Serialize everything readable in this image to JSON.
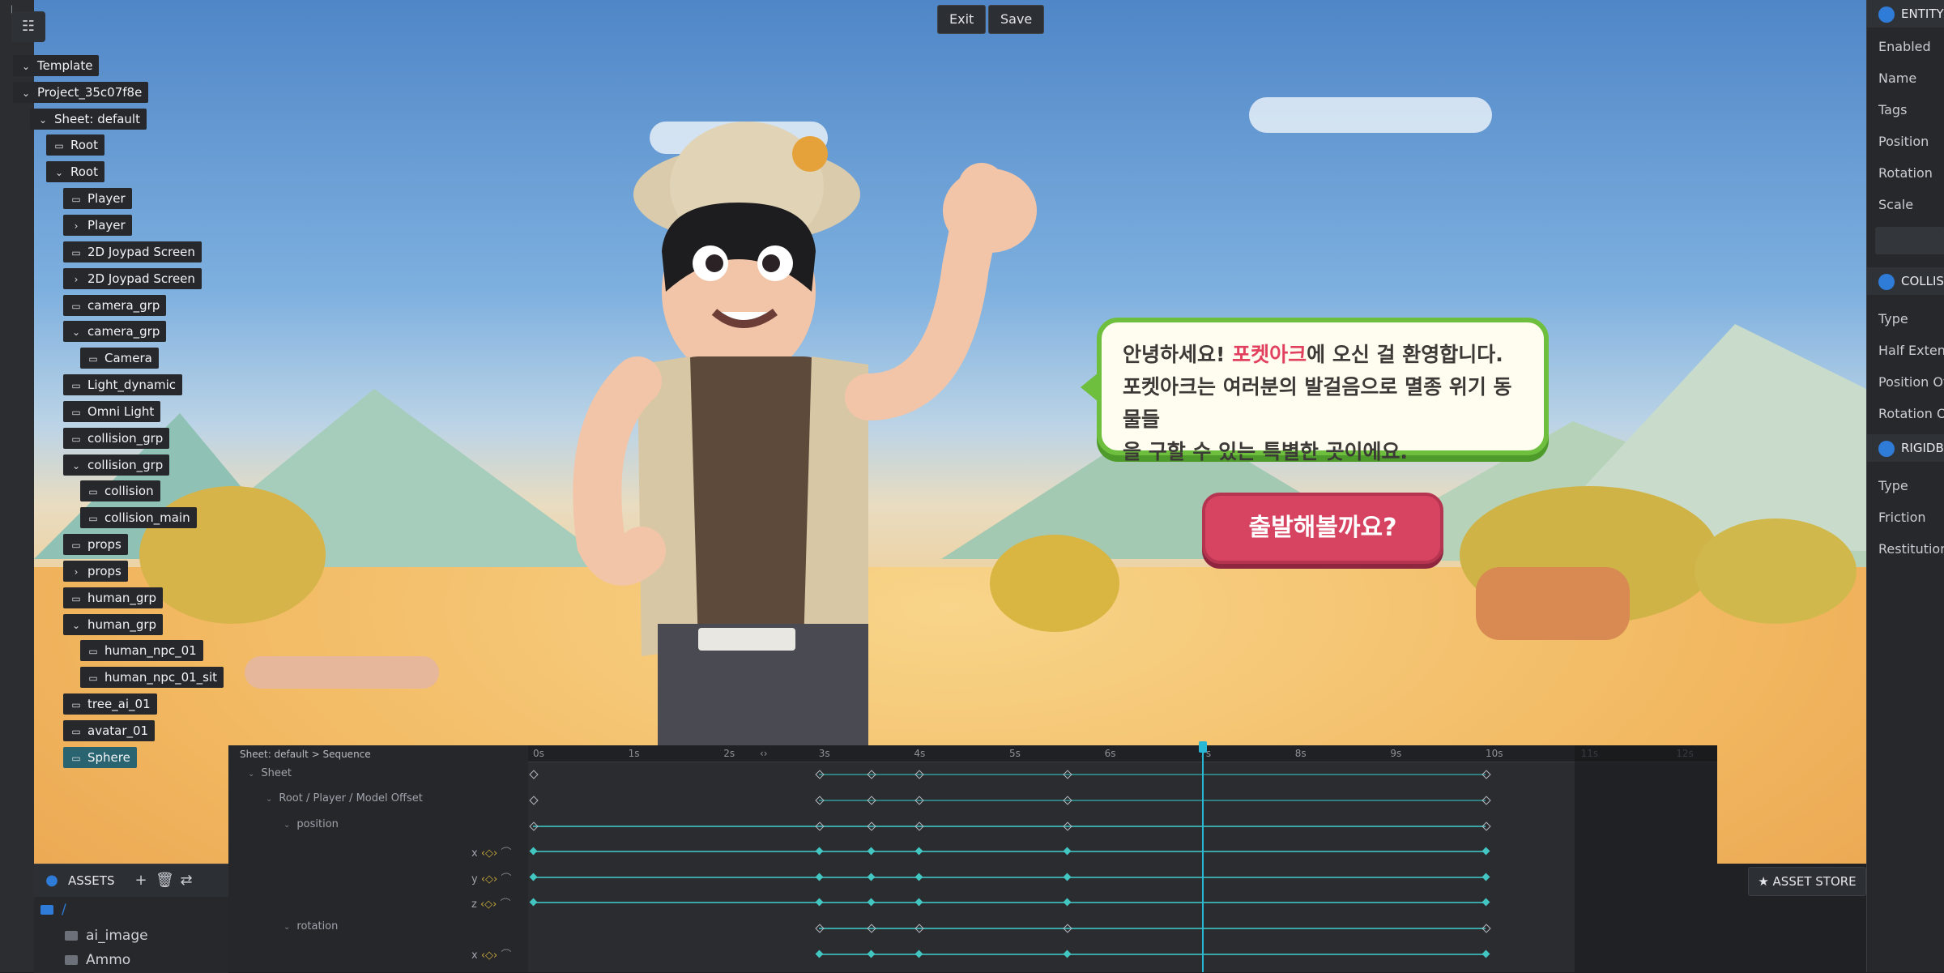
{
  "toolbar": {
    "exit_label": "Exit",
    "save_label": "Save"
  },
  "hierarchy": {
    "nodes": [
      {
        "label": "Template",
        "expanded": true,
        "icon": "chevron-down-icon"
      },
      {
        "label": "Project_35c07f8e",
        "expanded": true,
        "icon": "chevron-down-icon"
      },
      {
        "label": "Sheet: default",
        "expanded": true,
        "icon": "chevron-down-icon"
      },
      {
        "label": "Root",
        "icon": "entity-icon"
      },
      {
        "label": "Root",
        "icon": "chevron-down-icon"
      },
      {
        "label": "Player",
        "icon": "entity-icon"
      },
      {
        "label": "Player",
        "icon": "chevron-right-icon"
      },
      {
        "label": "2D Joypad Screen",
        "icon": "entity-icon"
      },
      {
        "label": "2D Joypad Screen",
        "icon": "chevron-right-icon"
      },
      {
        "label": "camera_grp",
        "icon": "entity-icon"
      },
      {
        "label": "camera_grp",
        "icon": "chevron-down-icon"
      },
      {
        "label": "Camera",
        "icon": "entity-icon"
      },
      {
        "label": "Light_dynamic",
        "icon": "entity-icon"
      },
      {
        "label": "Omni Light",
        "icon": "entity-icon"
      },
      {
        "label": "collision_grp",
        "icon": "entity-icon"
      },
      {
        "label": "collision_grp",
        "icon": "chevron-down-icon"
      },
      {
        "label": "collision",
        "icon": "entity-icon"
      },
      {
        "label": "collision_main",
        "icon": "entity-icon"
      },
      {
        "label": "props",
        "icon": "entity-icon"
      },
      {
        "label": "props",
        "icon": "chevron-right-icon"
      },
      {
        "label": "human_grp",
        "icon": "entity-icon"
      },
      {
        "label": "human_grp",
        "icon": "chevron-down-icon"
      },
      {
        "label": "human_npc_01",
        "icon": "entity-icon"
      },
      {
        "label": "human_npc_01_sit",
        "icon": "entity-icon"
      },
      {
        "label": "tree_ai_01",
        "icon": "entity-icon"
      },
      {
        "label": "avatar_01",
        "icon": "entity-icon"
      },
      {
        "label": "Sphere",
        "icon": "entity-icon",
        "selected": true
      }
    ]
  },
  "dialog": {
    "line1_a": "안녕하세요! ",
    "line1_highlight": "포켓아크",
    "line1_b": "에 오신 걸 환영합니다.",
    "line2": "포켓아크는 여러분의 발걸음으로 멸종 위기 동물들",
    "line3": "을 구할 수 있는 특별한 곳이에요.",
    "button_label": "출발해볼까요?",
    "accent": "#e1415f",
    "border": "#6fbf3f"
  },
  "inspector": {
    "sections": [
      {
        "title": "ENTITY",
        "rows": [
          "Enabled",
          "Name",
          "Tags",
          "Position",
          "Rotation",
          "Scale"
        ]
      },
      {
        "title": "COLLISION",
        "rows": [
          "Type",
          "Half Extents",
          "Position Offset",
          "Rotation Offset"
        ]
      },
      {
        "title": "RIGIDBODY",
        "rows": [
          "Type",
          "Friction",
          "Restitution"
        ]
      }
    ]
  },
  "timeline": {
    "path": "Sheet: default > Sequence",
    "ruler": [
      "0s",
      "1s",
      "2s",
      "3s",
      "4s",
      "5s",
      "6s",
      "7s",
      "8s",
      "9s",
      "10s",
      "11s",
      "12s"
    ],
    "tracks": [
      {
        "label": "Sheet"
      },
      {
        "label": "Root / Player / Model Offset"
      },
      {
        "label": "position"
      },
      {
        "label": "x"
      },
      {
        "label": "y"
      },
      {
        "label": "z"
      },
      {
        "label": "rotation"
      },
      {
        "label": "x"
      }
    ],
    "playhead_seconds": 7.0
  },
  "assets": {
    "title": "ASSETS",
    "root": "/",
    "folders": [
      "ai_image",
      "Ammo"
    ],
    "store_label": "ASSET STORE"
  }
}
